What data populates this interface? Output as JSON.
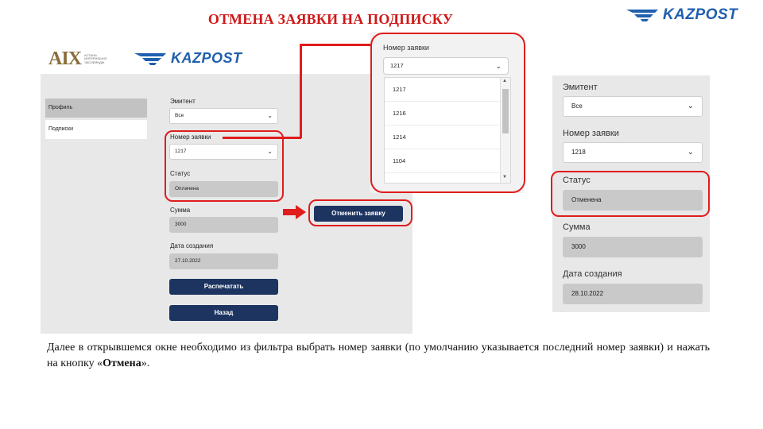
{
  "slide": {
    "title": "ОТМЕНА ЗАЯВКИ НА ПОДПИСКУ",
    "logo_text": "KAZPOST"
  },
  "main_screen": {
    "header": {
      "aix_logo": "AIX",
      "aix_caption": "АСТАНА ИНТЕРНЕШНЛ ЭКСЧЕЙНДЖ",
      "kazpost_logo": "KAZPOST"
    },
    "sidebar": [
      {
        "label": "Профиль",
        "active": true
      },
      {
        "label": "Подписки",
        "active": false
      }
    ],
    "fields": {
      "issuer_label": "Эмитент",
      "issuer_value": "Все",
      "request_label": "Номер заявки",
      "request_value": "1217",
      "status_label": "Статус",
      "status_value": "Оплачена",
      "amount_label": "Сумма",
      "amount_value": "3000",
      "date_label": "Дата создания",
      "date_value": "27.10.2022"
    },
    "buttons": {
      "cancel_request": "Отменить заявку",
      "print": "Распечатать",
      "back": "Назад"
    }
  },
  "dropdown_screen": {
    "label": "Номер заявки",
    "selected": "1217",
    "options": [
      "1217",
      "1216",
      "1214",
      "1104"
    ]
  },
  "result_screen": {
    "issuer_label": "Эмитент",
    "issuer_value": "Все",
    "request_label": "Номер заявки",
    "request_value": "1218",
    "status_label": "Статус",
    "status_value": "Отменена",
    "amount_label": "Сумма",
    "amount_value": "3000",
    "date_label": "Дата создания",
    "date_value": "28.10.2022"
  },
  "description": {
    "text": "Далее в открывшемся окне необходимо из фильтра выбрать номер заявки (по умолчанию указывается последний номер заявки) и нажать на кнопку «",
    "bold": "Отмена",
    "tail": "»."
  },
  "colors": {
    "accent_red": "#e01c1c",
    "button_navy": "#1d3461",
    "brand_blue": "#1f5fae"
  }
}
